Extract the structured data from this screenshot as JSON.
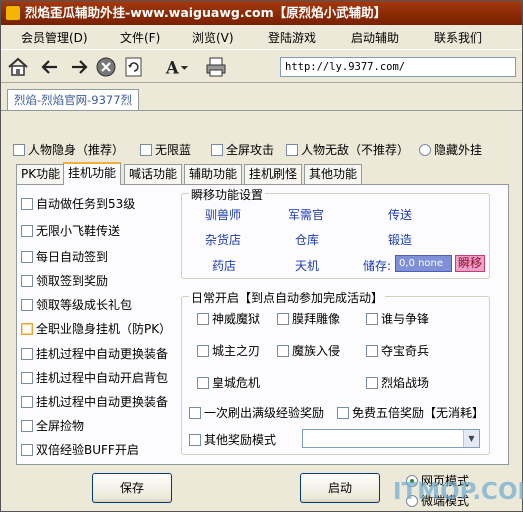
{
  "window": {
    "title": "烈焰歪瓜辅助外挂-www.waiguawg.com【原烈焰小武辅助】"
  },
  "menu": [
    "会员管理(D)",
    "文件(F)",
    "浏览(V)",
    "登陆游戏",
    "启动辅助",
    "联系我们"
  ],
  "toolbar": {
    "icons": [
      "home-icon",
      "back-arrow-icon",
      "forward-arrow-icon",
      "stop-icon",
      "refresh-icon",
      "font-icon",
      "print-icon"
    ],
    "url": "http://ly.9377.com/"
  },
  "browser_tab": {
    "label": "烈焰-烈焰官网-9377烈"
  },
  "top_options": [
    {
      "label": "人物隐身（推荐）",
      "type": "checkbox"
    },
    {
      "label": "无限蓝",
      "type": "checkbox"
    },
    {
      "label": "全屏攻击",
      "type": "checkbox"
    },
    {
      "label": "人物无敌（不推荐）",
      "type": "checkbox"
    },
    {
      "label": "隐藏外挂",
      "type": "radio"
    }
  ],
  "tabs": [
    "PK功能",
    "挂机功能",
    "喊话功能",
    "辅助功能",
    "挂机刷怪",
    "其他功能"
  ],
  "active_tab": "挂机功能",
  "left_options": [
    "自动做任务到53级",
    "无限小飞鞋传送",
    "每日自动签到",
    "领取签到奖励",
    "领取等级成长礼包",
    "全职业隐身挂机（防PK）",
    "挂机过程中自动更换装备",
    "挂机过程中自动开启背包",
    "挂机过程中自动更换装备",
    "全屏捡物",
    "双倍经验BUFF开启"
  ],
  "teleport": {
    "title": "瞬移功能设置",
    "links": [
      "驯兽师",
      "军需官",
      "传送",
      "杂货店",
      "仓库",
      "锻造",
      "药店",
      "天机"
    ],
    "storage_label": "储存:",
    "storage_value": "0,0 none",
    "teleport_button": "瞬移"
  },
  "daily": {
    "title": "日常开启【到点自动参加完成活动】",
    "options": [
      "神威魔狱",
      "膜拜雕像",
      "谁与争锋",
      "城主之刃",
      "魔族入侵",
      "夺宝奇兵",
      "皇城危机",
      "烈焰战场"
    ],
    "refresh_label": "一次刷出满级经验奖励",
    "free_label": "免费五倍奖励【无消耗】",
    "other_label": "其他奖励模式",
    "other_value": ""
  },
  "buttons": {
    "save": "保存",
    "start": "启动"
  },
  "mode": {
    "web": "网页模式",
    "micro": "微端模式"
  },
  "watermark": "ITMOP.COM",
  "colors": {
    "title_bar": "#8b2a06",
    "storage_bg": "#7f8fd8",
    "teleport_btn": "#f0a0c8",
    "link": "#1a3ab0"
  }
}
